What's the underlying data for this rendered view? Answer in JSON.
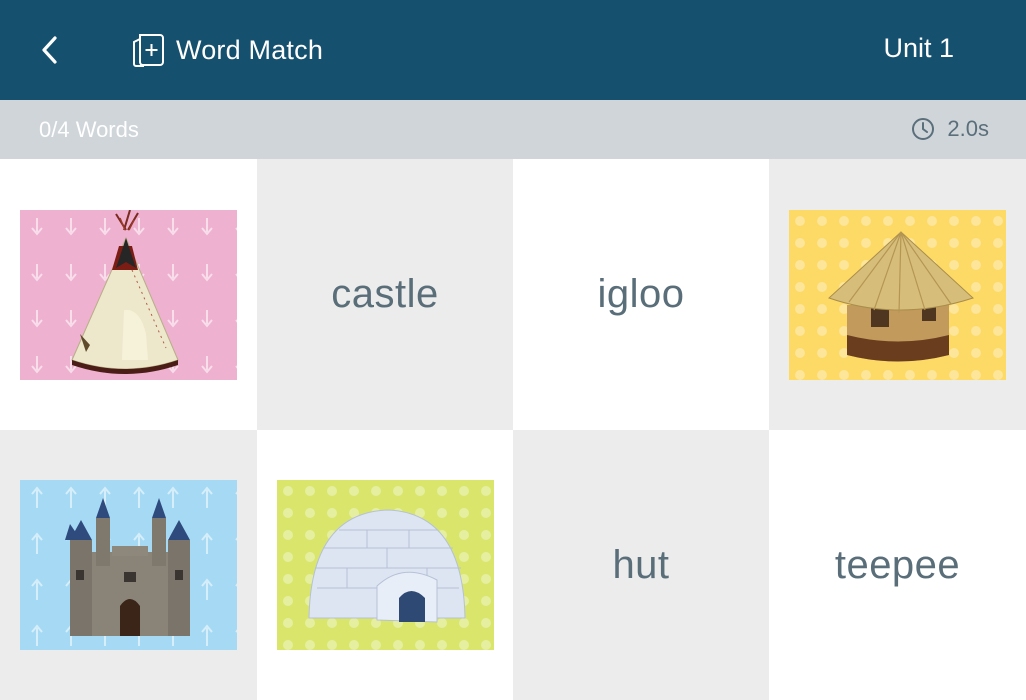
{
  "header": {
    "title": "Word Match",
    "unit": "Unit 1",
    "colors": {
      "bar": "#16506f",
      "text": "#ffffff"
    },
    "icons": {
      "back": "chevron-left-icon",
      "app": "add-card-icon"
    }
  },
  "status": {
    "progress": "0/4 Words",
    "timer": "2.0s",
    "icons": {
      "timer": "clock-icon"
    }
  },
  "grid": {
    "cells": [
      {
        "kind": "image",
        "image": "teepee-picture",
        "background": "pink-arrows"
      },
      {
        "kind": "word",
        "word": "castle"
      },
      {
        "kind": "word",
        "word": "igloo"
      },
      {
        "kind": "image",
        "image": "hut-picture",
        "background": "yellow-dots"
      },
      {
        "kind": "image",
        "image": "castle-picture",
        "background": "blue-arrows"
      },
      {
        "kind": "image",
        "image": "igloo-picture",
        "background": "green-dots"
      },
      {
        "kind": "word",
        "word": "hut"
      },
      {
        "kind": "word",
        "word": "teepee"
      }
    ]
  }
}
